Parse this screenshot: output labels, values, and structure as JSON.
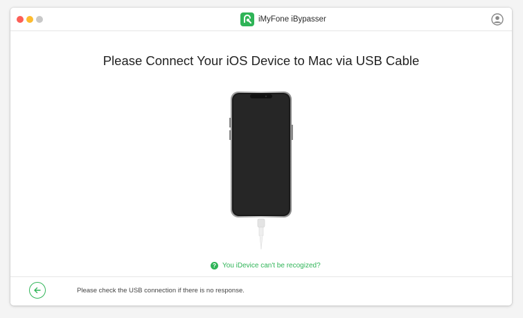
{
  "window": {
    "title": "iMyFone iBypasser"
  },
  "main": {
    "heading": "Please Connect Your iOS Device to Mac via USB Cable",
    "help_link": "You iDevice can't be recogized?"
  },
  "footer": {
    "message": "Please check the USB connection if there is no response."
  },
  "colors": {
    "accent": "#2fb457",
    "close": "#fc5f57",
    "minimize": "#fdbc2f",
    "maximize": "#c8c8c8"
  },
  "icons": {
    "account": "user-circle-icon",
    "back": "arrow-left-icon",
    "help": "question-circle-icon",
    "logo": "app-logo-icon"
  }
}
